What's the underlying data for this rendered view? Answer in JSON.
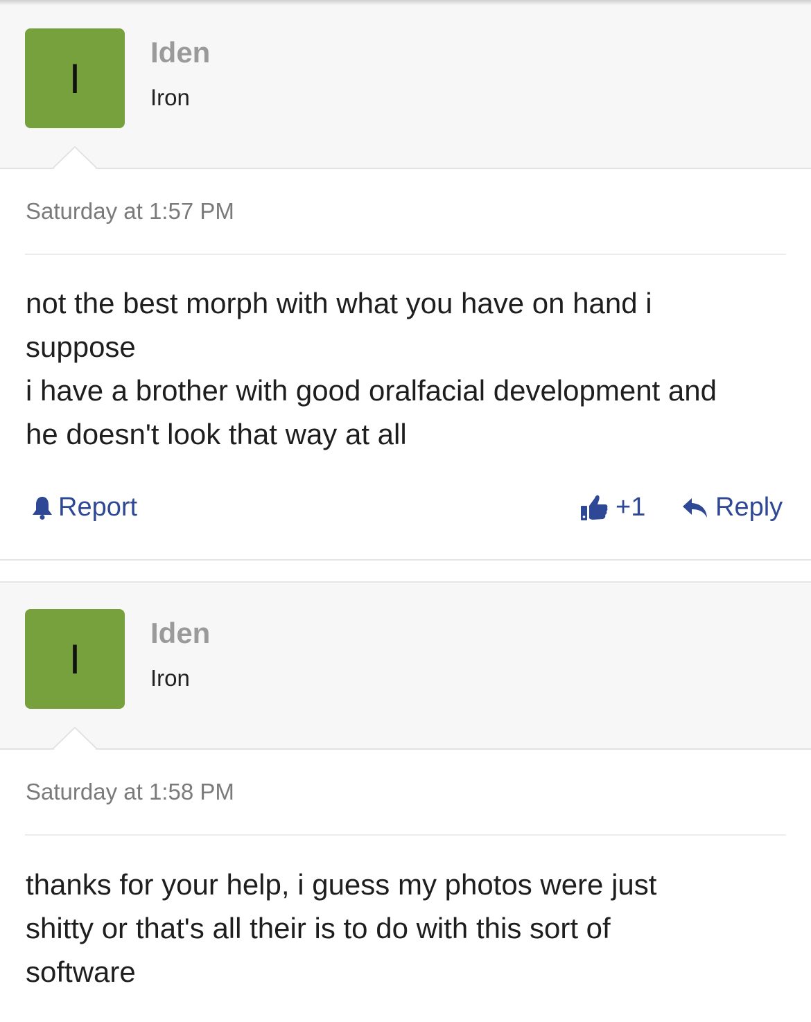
{
  "posts": [
    {
      "avatar_letter": "I",
      "avatar_color": "#76a13c",
      "username": "Iden",
      "user_title": "Iron",
      "timestamp": "Saturday at 1:57 PM",
      "message_lines": [
        "not the best morph with what you have on hand i",
        "suppose",
        "i have a brother with good oralfacial development and",
        "he doesn't look that way at all"
      ],
      "actions": {
        "report_label": "Report",
        "like_label": "+1",
        "reply_label": "Reply"
      }
    },
    {
      "avatar_letter": "I",
      "avatar_color": "#76a13c",
      "username": "Iden",
      "user_title": "Iron",
      "timestamp": "Saturday at 1:58 PM",
      "message_lines": [
        "thanks for your help, i guess my photos were just",
        "shitty or that's all their is to do with this sort of",
        "software"
      ]
    }
  ],
  "colors": {
    "action_link": "#2e4896",
    "username": "#9a9a9a",
    "header_bg": "#f7f7f7"
  },
  "icons": {
    "report": "bell-icon",
    "like": "thumbs-up-icon",
    "reply": "reply-arrow-icon"
  }
}
